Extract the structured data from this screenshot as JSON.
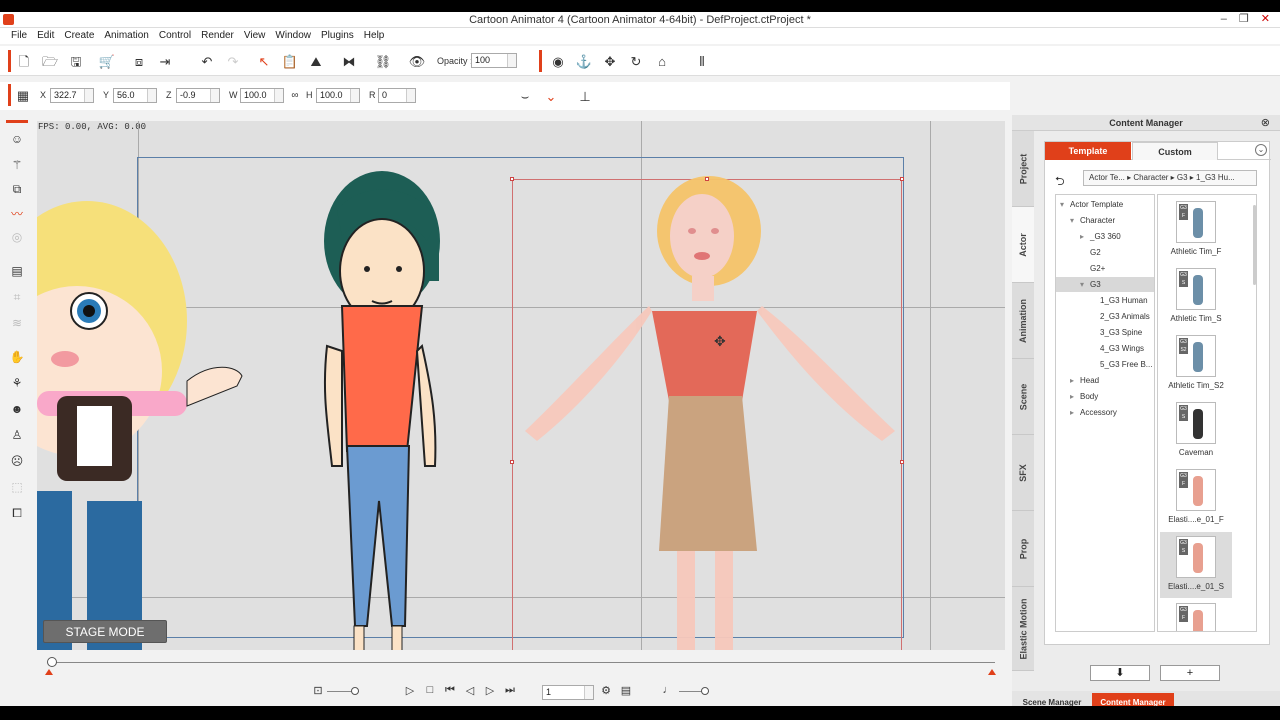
{
  "title": "Cartoon Animator 4  (Cartoon Animator 4-64bit) - DefProject.ctProject *",
  "window_buttons": {
    "minimize": "–",
    "restore": "❐",
    "close": "✕"
  },
  "menu": [
    "File",
    "Edit",
    "Create",
    "Animation",
    "Control",
    "Render",
    "View",
    "Window",
    "Plugins",
    "Help"
  ],
  "toolbar": {
    "opacity_label": "Opacity :",
    "opacity_value": "100"
  },
  "transform": {
    "x_label": "X",
    "x_value": "322.7",
    "y_label": "Y",
    "y_value": "56.0",
    "z_label": "Z",
    "z_value": "-0.9",
    "w_label": "W",
    "w_value": "100.0",
    "h_label": "H",
    "h_value": "100.0",
    "r_label": "R",
    "r_value": "0"
  },
  "viewport": {
    "fps_text": "FPS: 0.00, AVG: 0.00",
    "stage_mode": "STAGE MODE"
  },
  "timeline": {
    "frame": "1"
  },
  "content_manager": {
    "title": "Content Manager",
    "close": "⊗",
    "tabs": {
      "template": "Template",
      "custom": "Custom"
    },
    "side_tabs": [
      "Project",
      "Actor",
      "Animation",
      "Scene",
      "SFX",
      "Prop",
      "Elastic Motion"
    ],
    "breadcrumb": "Actor Te...  ▸  Character  ▸  G3  ▸  1_G3 Hu...",
    "tree": [
      {
        "label": "Actor Template",
        "arrow": "▾",
        "indent": 0
      },
      {
        "label": "Character",
        "arrow": "▾",
        "indent": 1
      },
      {
        "label": "_G3 360",
        "arrow": "▸",
        "indent": 2
      },
      {
        "label": "G2",
        "arrow": "",
        "indent": 2
      },
      {
        "label": "G2+",
        "arrow": "",
        "indent": 2
      },
      {
        "label": "G3",
        "arrow": "▾",
        "indent": 2
      },
      {
        "label": "1_G3 Human",
        "arrow": "",
        "indent": 3
      },
      {
        "label": "2_G3 Animals",
        "arrow": "",
        "indent": 3
      },
      {
        "label": "3_G3 Spine",
        "arrow": "",
        "indent": 3
      },
      {
        "label": "4_G3 Wings",
        "arrow": "",
        "indent": 3
      },
      {
        "label": "5_G3 Free B...",
        "arrow": "",
        "indent": 3
      },
      {
        "label": "Head",
        "arrow": "▸",
        "indent": 1
      },
      {
        "label": "Body",
        "arrow": "▸",
        "indent": 1
      },
      {
        "label": "Accessory",
        "arrow": "▸",
        "indent": 1
      }
    ],
    "thumbnails": [
      {
        "label": "Athletic Tim_F",
        "badge": "G3 F"
      },
      {
        "label": "Athletic Tim_S",
        "badge": "G3 S"
      },
      {
        "label": "Athletic Tim_S2",
        "badge": "G3 S2"
      },
      {
        "label": "Caveman",
        "badge": "G3 S"
      },
      {
        "label": "Elasti....e_01_F",
        "badge": "G3 F"
      },
      {
        "label": "Elasti....e_01_S",
        "badge": "G3 S"
      },
      {
        "label": "",
        "badge": "G3 F"
      }
    ],
    "download_btn": "⬇",
    "add_btn": "+",
    "bottom_tabs": {
      "scene": "Scene Manager",
      "content": "Content Manager"
    }
  },
  "colors": {
    "accent": "#e0401a"
  }
}
